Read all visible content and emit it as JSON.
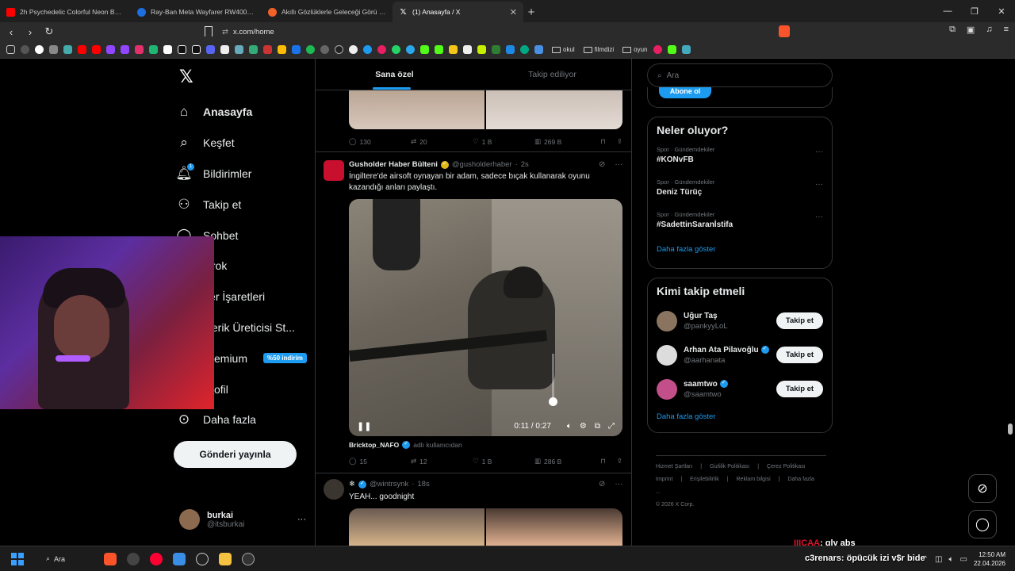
{
  "browser": {
    "tabs": [
      {
        "title": "2h Psychedelic Colorful Neon Backgr...",
        "color": "#ff0000"
      },
      {
        "title": "Ray-Ban Meta Wayfarer RW4006 60...",
        "color": "#1d6fe0"
      },
      {
        "title": "Akıllı Gözlüklerle Geleceği Görü H...",
        "color": "#f2612a"
      },
      {
        "title": "(1) Anasayfa / X",
        "color": "#000000",
        "active": true
      }
    ],
    "url": "x.com/home",
    "bookmark_folders": [
      "okul",
      "filmdizi",
      "oyun"
    ]
  },
  "x": {
    "nav": [
      {
        "icon": "home-icon",
        "label": "Anasayfa",
        "bold": true
      },
      {
        "icon": "search-icon",
        "label": "Keşfet"
      },
      {
        "icon": "bell-icon",
        "label": "Bildirimler",
        "badge": "1"
      },
      {
        "icon": "follow-icon",
        "label": "Takip et"
      },
      {
        "icon": "chat-icon",
        "label": "Sohbet"
      },
      {
        "icon": "grok-icon",
        "label": "Grok"
      },
      {
        "icon": "bookmark-icon",
        "label": "Yer İşaretleri"
      },
      {
        "icon": "creator-icon",
        "label": "İçerik Üreticisi St..."
      },
      {
        "icon": "premium-icon",
        "label": "Premium",
        "promo": "%50 indirim"
      },
      {
        "icon": "profile-icon",
        "label": "Profil"
      },
      {
        "icon": "more-icon",
        "label": "Daha fazla"
      }
    ],
    "post_button": "Gönderi yayınla",
    "account": {
      "name": "burkai",
      "handle": "@itsburkai"
    },
    "feed_tabs": [
      "Sana özel",
      "Takip ediliyor"
    ],
    "tweet0_stats": {
      "replies": "130",
      "reposts": "20",
      "likes": "1 B",
      "views": "269 B"
    },
    "tweet1": {
      "name": "Gusholder Haber Bülteni",
      "handle": "@gusholderhaber",
      "time": "2s",
      "text": "İngiltere'de airsoft oynayan bir adam, sadece bıçak kullanarak oyunu kazandığı anları paylaştı.",
      "video_time": "0:11 / 0:27",
      "credit_name": "Bricktop_NAFO",
      "credit_sub": "adlı kullanıcıdan",
      "stats": {
        "replies": "15",
        "reposts": "12",
        "likes": "1 B",
        "views": "286 B"
      }
    },
    "tweet2": {
      "name": "❄",
      "handle": "@wintrsynk",
      "time": "18s",
      "text": "YEAH... goodnight"
    },
    "search_placeholder": "Ara",
    "subscribe_label": "Abone ol",
    "trends_title": "Neler oluyor?",
    "trends": [
      {
        "category": "Spor · Gündemdekiler",
        "title": "#KONvFB"
      },
      {
        "category": "Spor · Gündemdekiler",
        "title": "Deniz Türüç"
      },
      {
        "category": "Spor · Gündemdekiler",
        "title": "#SadettinSaranİstifa"
      }
    ],
    "show_more": "Daha fazla göster",
    "who_title": "Kimi takip etmeli",
    "who": [
      {
        "name": "Uğur Taş",
        "handle": "@pankyyLoL",
        "verified": false,
        "color": "#8a7460"
      },
      {
        "name": "Arhan Ata Pilavoğlu",
        "handle": "@aarhanata",
        "verified": true,
        "color": "#dcdcdc"
      },
      {
        "name": "saamtwo",
        "handle": "@saamtwo",
        "verified": true,
        "color": "#c24f8a"
      }
    ],
    "follow_label": "Takip et",
    "footer": [
      "Hizmet Şartları",
      "Gizlilik Politikası",
      "Çerez Politikası",
      "Imprint",
      "Erişilebilirlik",
      "Reklam bilgisi",
      "Daha fazla ...",
      "© 2026 X Corp."
    ],
    "verified_color": "#1d9bf0",
    "gold_verified_color": "#e2b719"
  },
  "stream_chat": [
    {
      "user": "IIICAA",
      "msg": ": gly abş"
    },
    {
      "user": "c3renars",
      "msg": ": öpücük izi v$r bide"
    }
  ],
  "taskbar": {
    "search_label": "Ara",
    "time": "12:50 AM",
    "date": "22.04.2026"
  }
}
